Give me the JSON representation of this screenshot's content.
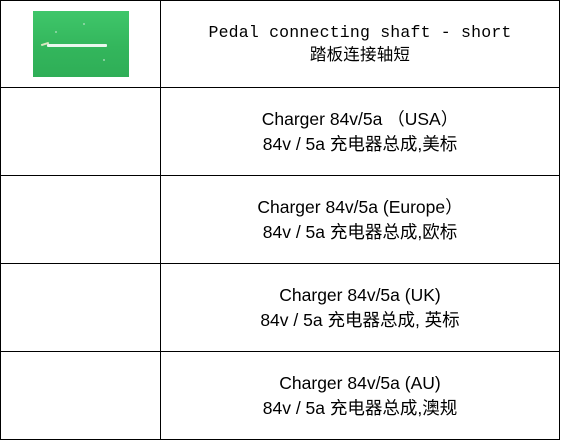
{
  "rows": [
    {
      "image": {
        "alt": "pedal-connecting-shaft-photo"
      },
      "name_en": "Pedal connecting shaft - short",
      "name_cn": "踏板连接轴短"
    },
    {
      "name_en": "Charger 84v/5a （USA）",
      "name_cn": "84v / 5a 充电器总成,美标"
    },
    {
      "name_en": "Charger 84v/5a (Europe）",
      "name_cn": "84v / 5a 充电器总成,欧标"
    },
    {
      "name_en": "Charger 84v/5a (UK)",
      "name_cn": "84v / 5a 充电器总成, 英标"
    },
    {
      "name_en": "Charger 84v/5a (AU)",
      "name_cn": "84v / 5a 充电器总成,澳规"
    }
  ]
}
